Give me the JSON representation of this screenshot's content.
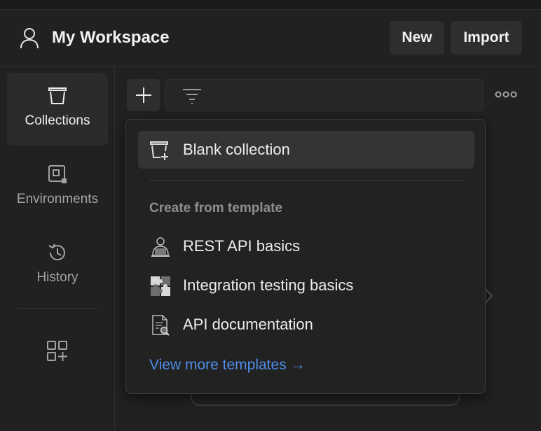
{
  "header": {
    "workspace_title": "My Workspace",
    "new_label": "New",
    "import_label": "Import"
  },
  "sidebar": {
    "items": [
      {
        "label": "Collections",
        "icon": "collections-icon",
        "active": true
      },
      {
        "label": "Environments",
        "icon": "environments-icon",
        "active": false
      },
      {
        "label": "History",
        "icon": "history-icon",
        "active": false
      }
    ],
    "apps_icon": "add-apps-icon"
  },
  "toolbar": {
    "add_icon": "plus-icon",
    "filter_icon": "filter-icon",
    "more_icon": "more-horizontal-icon"
  },
  "dropdown": {
    "blank_collection": "Blank collection",
    "template_heading": "Create from template",
    "templates": [
      {
        "label": "REST API basics",
        "icon": "rest-api-icon"
      },
      {
        "label": "Integration testing basics",
        "icon": "puzzle-icon"
      },
      {
        "label": "API documentation",
        "icon": "document-search-icon"
      }
    ],
    "view_more": "View more templates →"
  },
  "colors": {
    "background": "#212121",
    "accent_link": "#4f8ee6",
    "active_item": "#2b2b2b"
  }
}
